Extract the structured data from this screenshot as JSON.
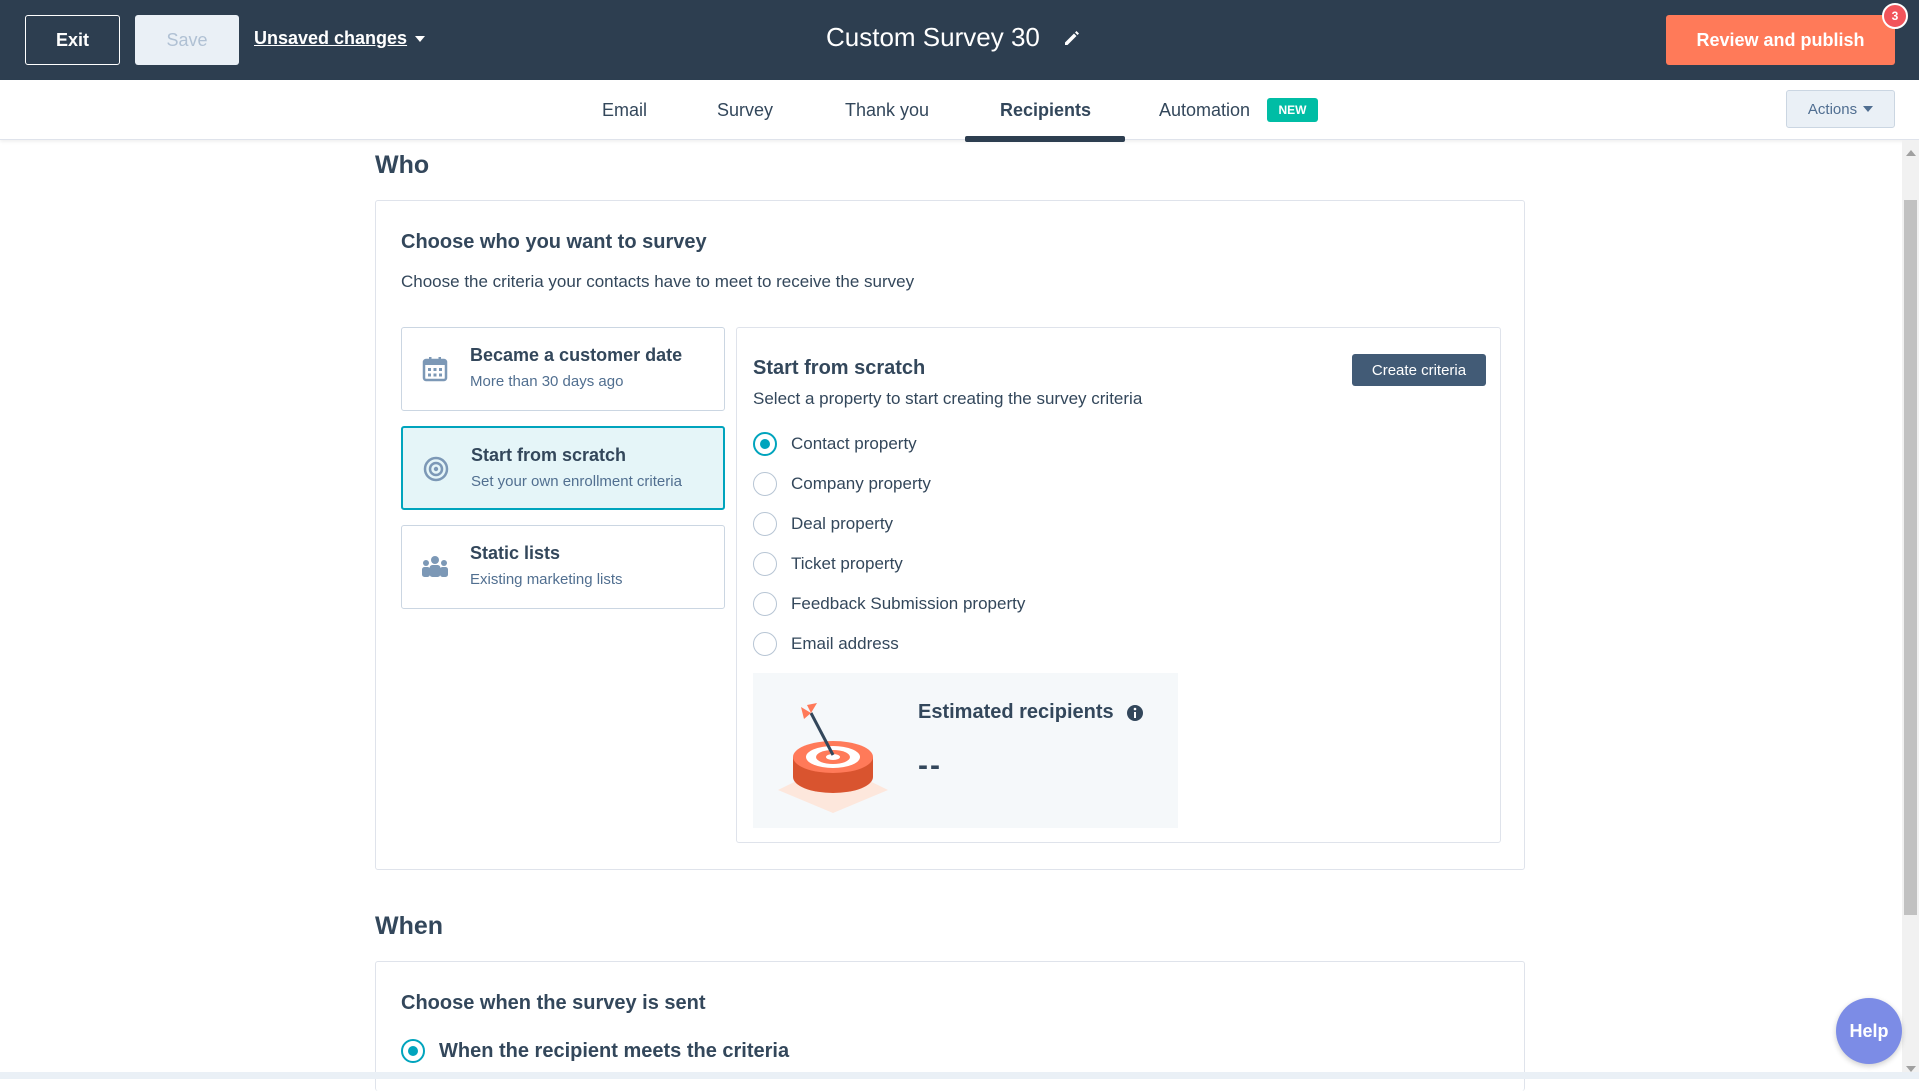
{
  "topbar": {
    "exit_label": "Exit",
    "save_label": "Save",
    "unsaved_label": "Unsaved changes",
    "title": "Custom Survey 30",
    "publish_label": "Review and publish",
    "notification_count": "3"
  },
  "tabs": {
    "items": [
      "Email",
      "Survey",
      "Thank you",
      "Recipients",
      "Automation"
    ],
    "active": "Recipients",
    "new_badge": "NEW",
    "actions_label": "Actions"
  },
  "who": {
    "heading": "Who",
    "card_title": "Choose who you want to survey",
    "card_sub": "Choose the criteria your contacts have to meet to receive the survey",
    "options": [
      {
        "title": "Became a customer date",
        "desc": "More than 30 days ago",
        "icon": "calendar-icon"
      },
      {
        "title": "Start from scratch",
        "desc": "Set your own enrollment criteria",
        "icon": "target-icon"
      },
      {
        "title": "Static lists",
        "desc": "Existing marketing lists",
        "icon": "people-icon"
      }
    ],
    "selected_option": "Start from scratch",
    "panel": {
      "title": "Start from scratch",
      "sub": "Select a property to start creating the survey criteria",
      "create_label": "Create criteria",
      "properties": [
        "Contact property",
        "Company property",
        "Deal property",
        "Ticket property",
        "Feedback Submission property",
        "Email address"
      ],
      "selected_property": "Contact property",
      "estimated_title": "Estimated recipients",
      "estimated_value": "--"
    }
  },
  "when": {
    "heading": "When",
    "card_title": "Choose when the survey is sent",
    "option_label": "When the recipient meets the criteria"
  },
  "help_label": "Help",
  "colors": {
    "topbar": "#2d3e50",
    "accent_orange": "#ff7a59",
    "accent_teal": "#00a4bd",
    "new_badge": "#00bda5"
  }
}
